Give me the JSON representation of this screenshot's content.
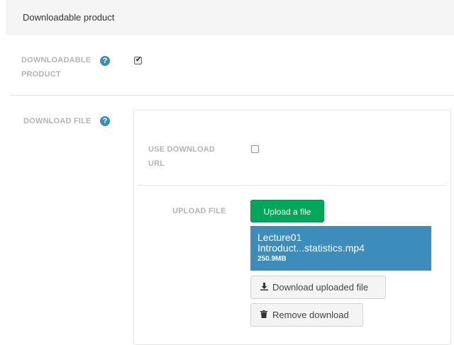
{
  "panel": {
    "title": "Downloadable product"
  },
  "downloadable": {
    "label_line1": "DOWNLOADABLE",
    "label_line2": "PRODUCT",
    "help_glyph": "?",
    "checked": true
  },
  "download_file": {
    "label": "DOWNLOAD FILE",
    "help_glyph": "?"
  },
  "use_url": {
    "label_line1": "USE DOWNLOAD",
    "label_line2": "URL",
    "checked": false
  },
  "upload": {
    "label": "UPLOAD FILE",
    "button_label": "Upload a file",
    "file_name_line1": "Lecture01",
    "file_name_line2": "Introduct...statistics.mp4",
    "file_size": "250.9MB",
    "download_button_label": "Download uploaded file",
    "remove_button_label": "Remove download"
  },
  "icons": {
    "download": "download-icon",
    "trash": "trash-icon"
  },
  "colors": {
    "accent": "#3c8dbc",
    "green": "#00a65a",
    "label": "#b5b5b5"
  }
}
